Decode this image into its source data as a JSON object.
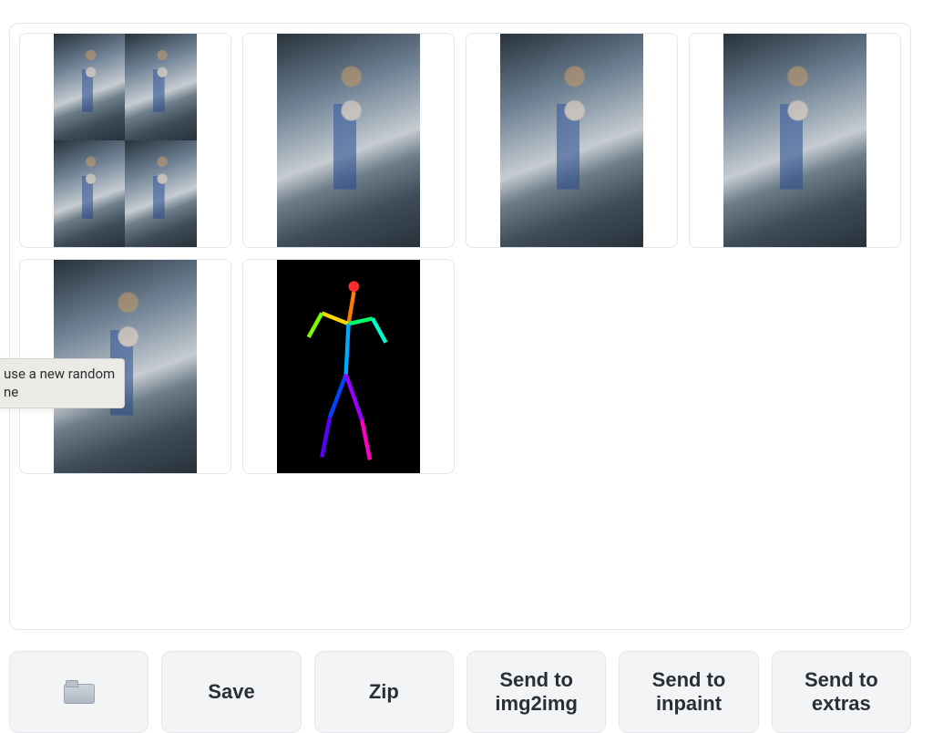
{
  "tooltip": {
    "text_line1": "use a new random",
    "text_line2": "ne"
  },
  "gallery": {
    "items": [
      {
        "kind": "collage",
        "alt": "2x2 grid of woman jumping on city sidewalk"
      },
      {
        "kind": "photo",
        "alt": "woman mid-jump, white top, jeans, storefront street"
      },
      {
        "kind": "photo",
        "alt": "woman jumping in front of shop window, denim outfit"
      },
      {
        "kind": "photo",
        "alt": "woman leaping near brick storefront, dark top, jeans"
      },
      {
        "kind": "photo",
        "alt": "woman jumping on narrow street, long hair, jeans"
      },
      {
        "kind": "pose",
        "alt": "OpenPose stick-figure skeleton on black"
      }
    ]
  },
  "actions": {
    "open_folder_aria": "Open output folder",
    "save": "Save",
    "zip": "Zip",
    "send_img2img": "Send to img2img",
    "send_inpaint": "Send to inpaint",
    "send_extras": "Send to extras"
  }
}
